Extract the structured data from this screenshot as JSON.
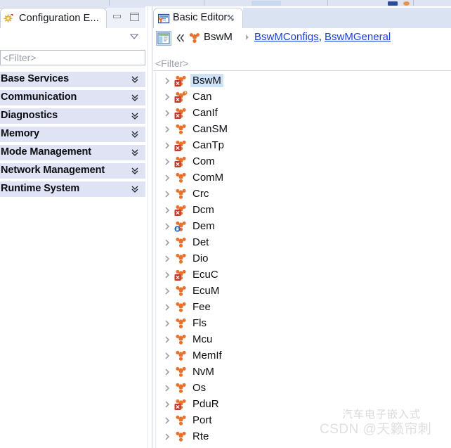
{
  "colors": {
    "accent_blue": "#1a3fd8",
    "selection_blue": "#cfe3f8",
    "section_header_bg": "#dfe3f3",
    "module_icon_orange": "#e8722c",
    "error_badge_red": "#c0392b",
    "lock_badge_blue": "#2b6cb8",
    "toolbar_bg": "#dfe4f2",
    "tab_inactive_bg": "#d9e3f2"
  },
  "toolbar": {
    "visible": true
  },
  "left_panel": {
    "tab": {
      "label": "Configuration E...",
      "icon": "configuration-editor-icon"
    },
    "window_controls": {
      "minimize_label": "Minimize",
      "maximize_label": "Maximize"
    },
    "view_menu_label": "View Menu",
    "filter": {
      "placeholder": "<Filter>",
      "value": ""
    },
    "sections": [
      {
        "label": "Base Services",
        "expand_icon": "double-chevron-down-icon"
      },
      {
        "label": "Communication",
        "expand_icon": "double-chevron-down-icon"
      },
      {
        "label": "Diagnostics",
        "expand_icon": "double-chevron-down-icon"
      },
      {
        "label": "Memory",
        "expand_icon": "double-chevron-down-icon"
      },
      {
        "label": "Mode Management",
        "expand_icon": "double-chevron-down-icon"
      },
      {
        "label": "Network Management",
        "expand_icon": "double-chevron-down-icon"
      },
      {
        "label": "Runtime System",
        "expand_icon": "double-chevron-down-icon"
      }
    ]
  },
  "right_panel": {
    "tab": {
      "label": "Basic Editor",
      "icon": "basic-editor-icon",
      "close_icon": "close-icon",
      "active": true
    },
    "breadcrumb": {
      "view_icon": "layout-view-icon",
      "back_icon": "double-left-arrow-icon",
      "module_icon": "bswm-module-icon",
      "module_name": "BswM",
      "separator_icon": "chevron-right-icon",
      "links": [
        {
          "label": "BswMConfigs"
        },
        {
          "label": "BswMGeneral"
        }
      ],
      "link_separator": ", "
    },
    "filter": {
      "placeholder": "<Filter>",
      "value": ""
    },
    "tree": {
      "items": [
        {
          "label": "BswM",
          "icon": "module-icon",
          "badge": "error",
          "selected": true,
          "expanded": false
        },
        {
          "label": "Can",
          "icon": "module-icon",
          "badge": "error-ring",
          "selected": false,
          "expanded": false
        },
        {
          "label": "CanIf",
          "icon": "module-icon",
          "badge": "error",
          "selected": false,
          "expanded": false
        },
        {
          "label": "CanSM",
          "icon": "module-icon",
          "badge": "none",
          "selected": false,
          "expanded": false
        },
        {
          "label": "CanTp",
          "icon": "module-icon",
          "badge": "error",
          "selected": false,
          "expanded": false
        },
        {
          "label": "Com",
          "icon": "module-icon",
          "badge": "error",
          "selected": false,
          "expanded": false
        },
        {
          "label": "ComM",
          "icon": "module-icon",
          "badge": "none",
          "selected": false,
          "expanded": false
        },
        {
          "label": "Crc",
          "icon": "module-icon",
          "badge": "none",
          "selected": false,
          "expanded": false
        },
        {
          "label": "Dcm",
          "icon": "module-icon",
          "badge": "error",
          "selected": false,
          "expanded": false
        },
        {
          "label": "Dem",
          "icon": "module-icon",
          "badge": "lock",
          "selected": false,
          "expanded": false
        },
        {
          "label": "Det",
          "icon": "module-icon",
          "badge": "none",
          "selected": false,
          "expanded": false
        },
        {
          "label": "Dio",
          "icon": "module-icon",
          "badge": "none",
          "selected": false,
          "expanded": false
        },
        {
          "label": "EcuC",
          "icon": "module-icon",
          "badge": "error",
          "selected": false,
          "expanded": false
        },
        {
          "label": "EcuM",
          "icon": "module-icon",
          "badge": "none",
          "selected": false,
          "expanded": false
        },
        {
          "label": "Fee",
          "icon": "module-icon",
          "badge": "none",
          "selected": false,
          "expanded": false
        },
        {
          "label": "Fls",
          "icon": "module-icon",
          "badge": "none",
          "selected": false,
          "expanded": false
        },
        {
          "label": "Mcu",
          "icon": "module-icon",
          "badge": "none",
          "selected": false,
          "expanded": false
        },
        {
          "label": "MemIf",
          "icon": "module-icon",
          "badge": "none",
          "selected": false,
          "expanded": false
        },
        {
          "label": "NvM",
          "icon": "module-icon",
          "badge": "none",
          "selected": false,
          "expanded": false
        },
        {
          "label": "Os",
          "icon": "module-icon",
          "badge": "none",
          "selected": false,
          "expanded": false
        },
        {
          "label": "PduR",
          "icon": "module-icon",
          "badge": "error",
          "selected": false,
          "expanded": false
        },
        {
          "label": "Port",
          "icon": "module-icon",
          "badge": "none",
          "selected": false,
          "expanded": false
        },
        {
          "label": "Rte",
          "icon": "module-icon",
          "badge": "none",
          "selected": false,
          "expanded": false
        }
      ]
    }
  },
  "watermark": {
    "line1": "汽车电子嵌入式",
    "line2": "CSDN @天籁帘刺"
  }
}
